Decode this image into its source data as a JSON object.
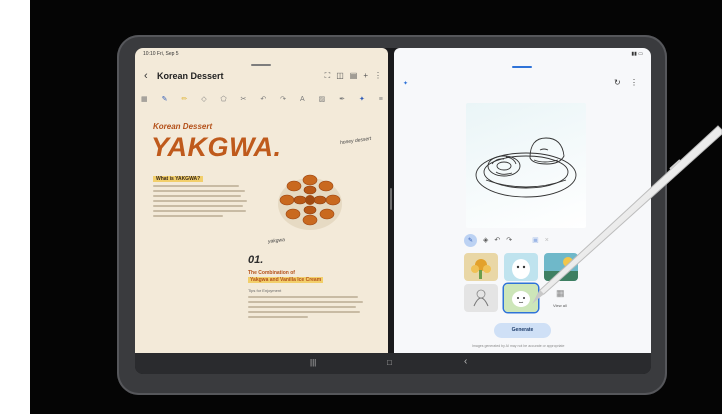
{
  "left_pane": {
    "status_time": "10:10 Fri, Sep 5",
    "back_icon": "chevron-left-icon",
    "note_title": "Korean Dessert",
    "header_icons": [
      "reading-mode-icon",
      "book-icon",
      "page-icon",
      "add-icon",
      "more-vert-icon"
    ],
    "toolbar_icons": [
      "template-icon",
      "pen-icon",
      "highlighter-icon",
      "eraser-icon",
      "shape-icon",
      "lasso-icon",
      "undo-icon",
      "redo-icon",
      "text-icon",
      "image-icon",
      "pen-settings-icon",
      "ai-assist-icon",
      "more-icon"
    ],
    "document": {
      "kicker": "Korean Dessert",
      "heading": "YAKGWA.",
      "question": "What is YAKGWA?",
      "handwritten_note_1": "honey dessert",
      "handwritten_note_2": "yakgwa",
      "section_number": "01.",
      "section_line_1": "The Combination of",
      "section_line_2": "Yakgwa and Vanilla Ice Cream",
      "tips_label": "Tips for Enjoyment"
    }
  },
  "right_pane": {
    "status_icons": "signal wifi battery",
    "header_icons": [
      "pin-icon",
      "refresh-icon",
      "more-vert-icon"
    ],
    "sketch_tools": [
      "pen-select-icon",
      "eraser-icon",
      "undo-icon",
      "redo-icon",
      "style-icon",
      "close-icon"
    ],
    "style_options": [
      "flower-watercolor",
      "character-3d",
      "flat-color",
      "sketch-pencil",
      "anime-style",
      "more-styles"
    ],
    "more_label": "View all",
    "generate_label": "Generate",
    "disclaimer": "Images generated by AI may not be accurate or appropriate"
  },
  "nav_bar": {
    "recents_icon": "|||",
    "home_icon": "□",
    "back_icon": "‹"
  },
  "colors": {
    "accent": "#2f73d8",
    "doc_title": "#bf5a1c",
    "highlight": "#f2cf6b",
    "paper": "#f3ead9"
  }
}
